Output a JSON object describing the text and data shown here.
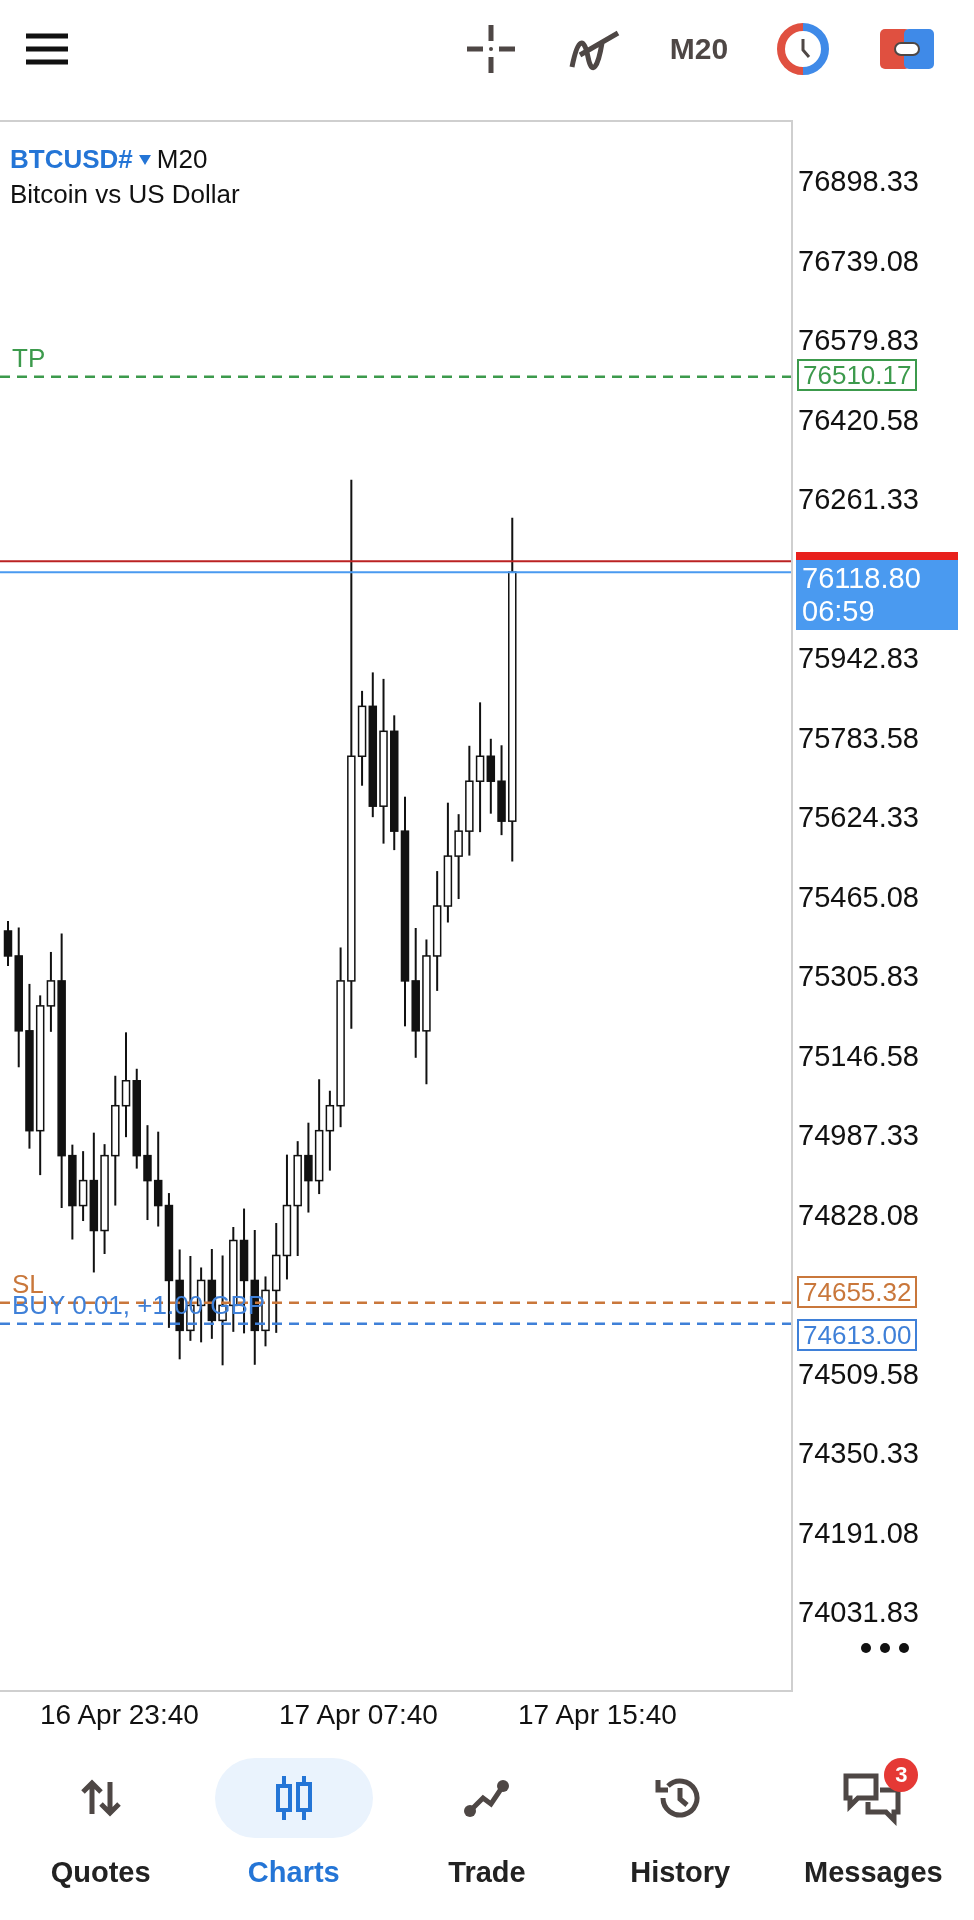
{
  "top_bar": {
    "timeframe": "M20"
  },
  "chart": {
    "symbol": "BTCUSD#",
    "timeframe": "M20",
    "description": "Bitcoin vs US Dollar",
    "price_axis": [
      "76898.33",
      "76739.08",
      "76579.83",
      "76420.58",
      "76261.33",
      "75942.83",
      "75783.58",
      "75624.33",
      "75465.08",
      "75305.83",
      "75146.58",
      "74987.33",
      "74828.08",
      "74509.58",
      "74350.33",
      "74191.08",
      "74031.83"
    ],
    "levels": [
      {
        "label": "TP",
        "price": "76510.17",
        "color": "#3c9a4c"
      },
      {
        "label": "SL",
        "price": "74655.32",
        "color": "#c9773b"
      },
      {
        "label": "BUY 0.01, +1.00 GBP",
        "price": "74613.00",
        "color": "#3f80d8"
      }
    ],
    "bid": {
      "price": "76118.80",
      "countdown": "06:59"
    },
    "time_axis": [
      "16 Apr 23:40",
      "17 Apr 07:40",
      "17 Apr 15:40"
    ]
  },
  "nav": [
    {
      "label": "Quotes",
      "selected": false
    },
    {
      "label": "Charts",
      "selected": true
    },
    {
      "label": "Trade",
      "selected": false
    },
    {
      "label": "History",
      "selected": false
    },
    {
      "label": "Messages",
      "selected": false,
      "badge": "3"
    }
  ]
}
